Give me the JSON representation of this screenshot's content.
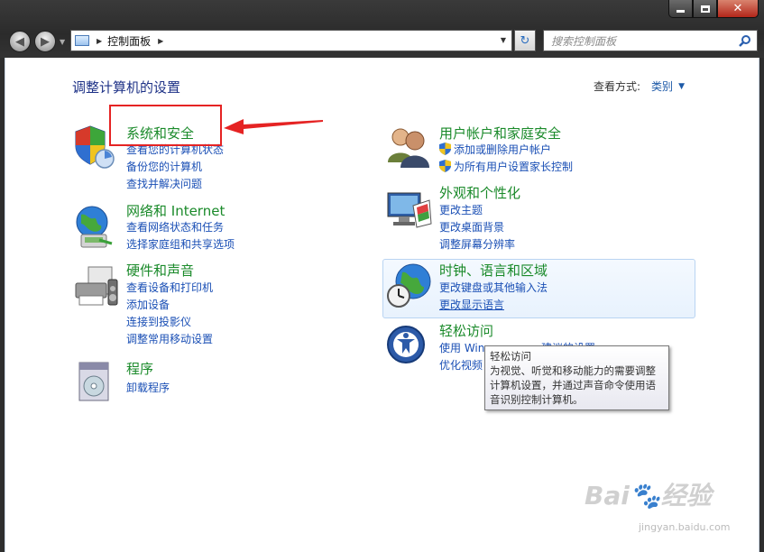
{
  "window": {
    "buttons": [
      "minimize",
      "maximize",
      "close"
    ]
  },
  "toolbar": {
    "back_icon": "back-arrow-icon",
    "forward_icon": "forward-arrow-icon",
    "address": "控制面板",
    "search_placeholder": "搜索控制面板"
  },
  "header": {
    "title": "调整计算机的设置",
    "view_by_label": "查看方式:",
    "view_by_value": "类别"
  },
  "categories": {
    "system": {
      "title": "系统和安全",
      "links": [
        "查看您的计算机状态",
        "备份您的计算机",
        "查找并解决问题"
      ]
    },
    "network": {
      "title": "网络和 Internet",
      "links": [
        "查看网络状态和任务",
        "选择家庭组和共享选项"
      ]
    },
    "hardware": {
      "title": "硬件和声音",
      "links": [
        "查看设备和打印机",
        "添加设备",
        "连接到投影仪",
        "调整常用移动设置"
      ]
    },
    "programs": {
      "title": "程序",
      "links": [
        "卸载程序"
      ]
    },
    "users": {
      "title": "用户帐户和家庭安全",
      "links": [
        "添加或删除用户帐户",
        "为所有用户设置家长控制"
      ]
    },
    "appearance": {
      "title": "外观和个性化",
      "links": [
        "更改主题",
        "更改桌面背景",
        "调整屏幕分辨率"
      ]
    },
    "clock": {
      "title": "时钟、语言和区域",
      "links": [
        "更改键盘或其他输入法",
        "更改显示语言"
      ]
    },
    "ease": {
      "title": "轻松访问",
      "links": [
        "使用 Win",
        "建议的设置",
        "优化视频"
      ]
    }
  },
  "tooltip": {
    "title": "轻松访问",
    "text": "为视觉、听觉和移动能力的需要调整计算机设置，并通过声音命令使用语音识别控制计算机。"
  },
  "watermark": {
    "brand": "Bai🐾经验",
    "url": "jingyan.baidu.com"
  },
  "colors": {
    "title_green": "#1a8a2a",
    "link_blue": "#1a4fb5",
    "heading_blue": "#1e3287",
    "annotation_red": "#e52323"
  }
}
